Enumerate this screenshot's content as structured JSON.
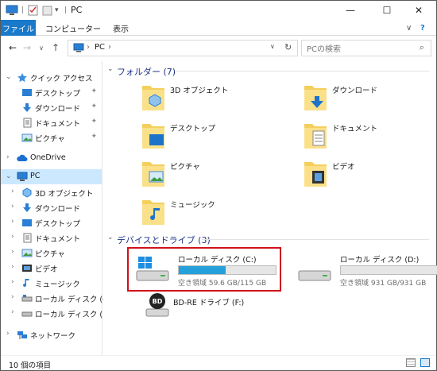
{
  "titlebar": {
    "title": "PC",
    "minimize": "—",
    "maximize": "☐",
    "close": "✕"
  },
  "ribbon": {
    "tabs": [
      "ファイル",
      "コンピューター",
      "表示"
    ],
    "expand": "∨",
    "help": "?"
  },
  "address": {
    "path": "PC",
    "sep1": "›",
    "sep2": "›",
    "search_placeholder": "PCの検索"
  },
  "nav": {
    "quick_access": "クイック アクセス",
    "quick_items": [
      "デスクトップ",
      "ダウンロード",
      "ドキュメント",
      "ピクチャ"
    ],
    "onedrive": "OneDrive",
    "pc": "PC",
    "pc_items": [
      "3D オブジェクト",
      "ダウンロード",
      "デスクトップ",
      "ドキュメント",
      "ピクチャ",
      "ビデオ",
      "ミュージック",
      "ローカル ディスク (C:)",
      "ローカル ディスク (D:)"
    ],
    "network": "ネットワーク"
  },
  "content": {
    "folders_header": "フォルダー (7)",
    "folders": [
      "3D オブジェクト",
      "ダウンロード",
      "デスクトップ",
      "ドキュメント",
      "ピクチャ",
      "ビデオ",
      "ミュージック"
    ],
    "devices_header": "デバイスとドライブ (3)",
    "drives": [
      {
        "name": "ローカル ディスク (C:)",
        "free": "空き領域 59.6 GB/115 GB",
        "used_fraction": 0.48
      },
      {
        "name": "ローカル ディスク (D:)",
        "free": "空き領域 931 GB/931 GB",
        "used_fraction": 0.0
      },
      {
        "name": "BD-RE ドライブ (F:)"
      }
    ]
  },
  "status": {
    "count": "10 個の項目"
  },
  "colors": {
    "accent": "#1979ca",
    "selection": "#cce8ff",
    "highlight_box": "#d0121b",
    "bar_fill": "#26a0da",
    "section_title": "#1e3287"
  }
}
